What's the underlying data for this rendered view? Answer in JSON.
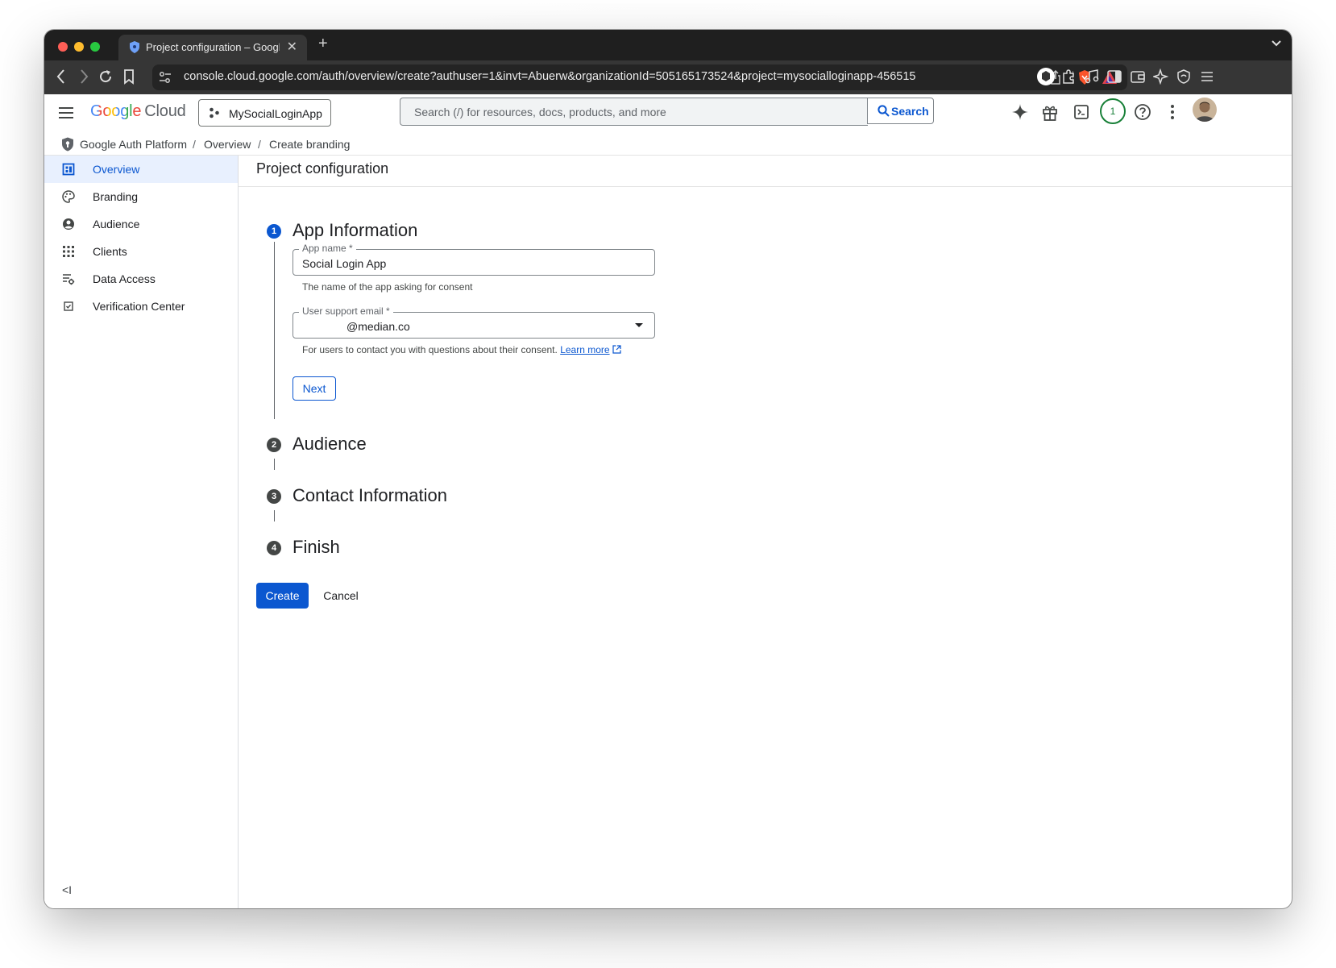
{
  "browser": {
    "tab_title": "Project configuration – Googl",
    "url": "console.cloud.google.com/auth/overview/create?authuser=1&invt=Abuerw&organizationId=505165173524&project=mysocialloginapp-456515"
  },
  "header": {
    "logo_google": "Google",
    "logo_cloud": "Cloud",
    "project": "MySocialLoginApp",
    "search_placeholder": "Search (/) for resources, docs, products, and more",
    "search_button": "Search",
    "notifications_count": "1"
  },
  "breadcrumb": [
    "Google Auth Platform",
    "Overview",
    "Create branding"
  ],
  "sidebar": {
    "items": [
      {
        "label": "Overview",
        "icon": "dashboard-icon",
        "active": true
      },
      {
        "label": "Branding",
        "icon": "palette-icon",
        "active": false
      },
      {
        "label": "Audience",
        "icon": "account-circle-icon",
        "active": false
      },
      {
        "label": "Clients",
        "icon": "apps-grid-icon",
        "active": false
      },
      {
        "label": "Data Access",
        "icon": "data-settings-icon",
        "active": false
      },
      {
        "label": "Verification Center",
        "icon": "checkbox-icon",
        "active": false
      }
    ],
    "collapse_label": "<I"
  },
  "page": {
    "title": "Project configuration",
    "steps": [
      {
        "number": "1",
        "title": "App Information"
      },
      {
        "number": "2",
        "title": "Audience"
      },
      {
        "number": "3",
        "title": "Contact Information"
      },
      {
        "number": "4",
        "title": "Finish"
      }
    ],
    "app_name": {
      "label": "App name *",
      "value": "Social Login App",
      "hint": "The name of the app asking for consent"
    },
    "support_email": {
      "label": "User support email *",
      "value": "@median.co",
      "hint": "For users to contact you with questions about their consent.",
      "learn_more": "Learn more"
    },
    "next_button": "Next",
    "create_button": "Create",
    "cancel_button": "Cancel"
  },
  "colors": {
    "accent": "#0b57d0",
    "active_nav_bg": "#e8f0fe",
    "step_active": "#0b57d0",
    "step_inactive": "#444746"
  }
}
